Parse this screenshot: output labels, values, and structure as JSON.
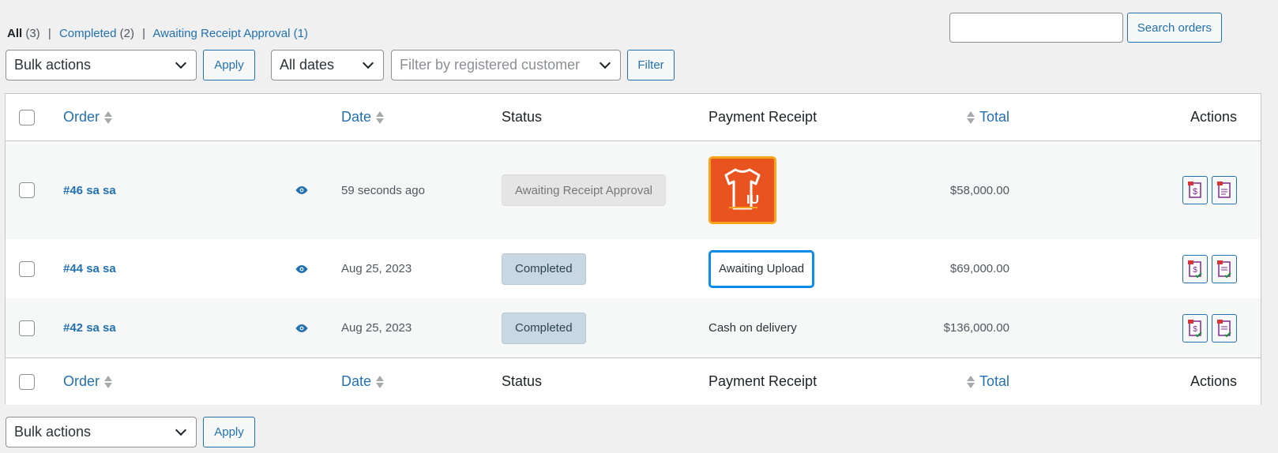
{
  "filters": {
    "all_label": "All",
    "all_count": "(3)",
    "completed_label": "Completed",
    "completed_count": "(2)",
    "awaiting_label": "Awaiting Receipt Approval (1)",
    "separator": "|"
  },
  "search": {
    "placeholder": "",
    "button": "Search orders"
  },
  "toolbar_top": {
    "bulk_actions": "Bulk actions",
    "apply": "Apply",
    "dates": "All dates",
    "customer_placeholder": "Filter by registered customer",
    "filter": "Filter"
  },
  "columns": {
    "order": "Order",
    "date": "Date",
    "status": "Status",
    "receipt": "Payment Receipt",
    "total": "Total",
    "actions": "Actions"
  },
  "orders": [
    {
      "id": "#46 sa sa",
      "date": "59 seconds ago",
      "status": "Awaiting Receipt Approval",
      "receipt": "",
      "receipt_logo_text": "IU",
      "total": "$58,000.00"
    },
    {
      "id": "#44 sa sa",
      "date": "Aug 25, 2023",
      "status": "Completed",
      "receipt": "Awaiting Upload",
      "total": "$69,000.00"
    },
    {
      "id": "#42 sa sa",
      "date": "Aug 25, 2023",
      "status": "Completed",
      "receipt": "Cash on delivery",
      "total": "$136,000.00"
    }
  ],
  "toolbar_bottom": {
    "bulk_actions": "Bulk actions",
    "apply": "Apply"
  },
  "colors": {
    "accent": "#2271b1",
    "completed_bg": "#c8d7e1",
    "awaiting_bg": "#e5e5e5",
    "receipt_orange": "#e9531f",
    "upload_border": "#0c8be9"
  },
  "icons": {
    "eye": "eye-icon",
    "invoice": "invoice-dollar-icon",
    "packing_slip": "packing-slip-icon",
    "sort": "sort-arrows-icon",
    "chevron": "chevron-down-icon"
  }
}
